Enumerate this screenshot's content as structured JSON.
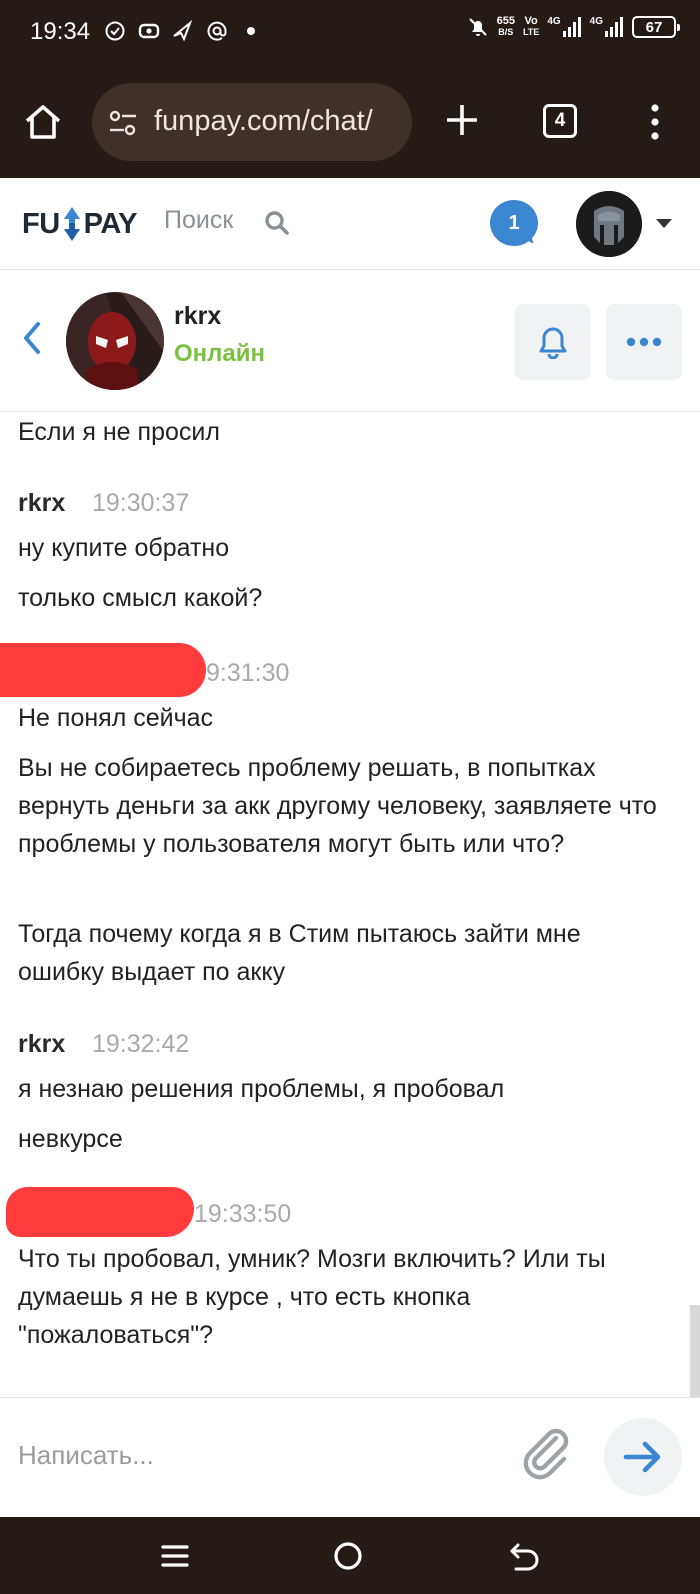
{
  "status_bar": {
    "time": "19:34",
    "speed": "655",
    "speed_unit": "B/S",
    "volte_top": "Vo",
    "volte_bottom": "LTE",
    "net1": "4G",
    "net2": "4G",
    "battery": "67",
    "icons": [
      "check-circle-icon",
      "vpn-icon",
      "send-icon",
      "at-icon",
      "dot-icon",
      "bell-muted-icon"
    ]
  },
  "browser": {
    "url": "funpay.com/chat/",
    "tab_count": "4"
  },
  "header": {
    "logo_left": "FU",
    "logo_right": "PAY",
    "search_label": "Поиск",
    "notification_count": "1"
  },
  "chat": {
    "contact_name": "rkrx",
    "contact_status": "Онлайн",
    "messages": [
      {
        "author": "",
        "time": "",
        "lines": [
          "Если я не просил"
        ]
      },
      {
        "author": "rkrx",
        "time": "19:30:37",
        "lines": [
          "ну купите обратно",
          "только смысл какой?"
        ]
      },
      {
        "author": "[redacted]",
        "time": "9:31:30",
        "lines": [
          "Не понял сейчас",
          "Вы не собираетесь проблему решать, в попытках вернуть деньги за акк другому человеку, заявляете что проблемы у пользователя могут быть или что?",
          "Тогда почему когда я в Стим пытаюсь зайти мне ошибку выдает по акку"
        ]
      },
      {
        "author": "rkrx",
        "time": "19:32:42",
        "lines": [
          "я незнаю решения проблемы, я пробовал",
          "невкурсе"
        ]
      },
      {
        "author": "[redacted]",
        "time": "19:33:50",
        "lines": [
          "Что ты пробовал, умник? Мозги включить? Или ты думаешь я не в курсе , что есть кнопка \"пожаловаться\"?"
        ]
      }
    ]
  },
  "composer": {
    "placeholder": "Написать..."
  },
  "colors": {
    "brand_blue": "#3a86d1",
    "online_green": "#7ac142",
    "redaction": "#ff3b3b",
    "system_bar": "#251b16"
  }
}
